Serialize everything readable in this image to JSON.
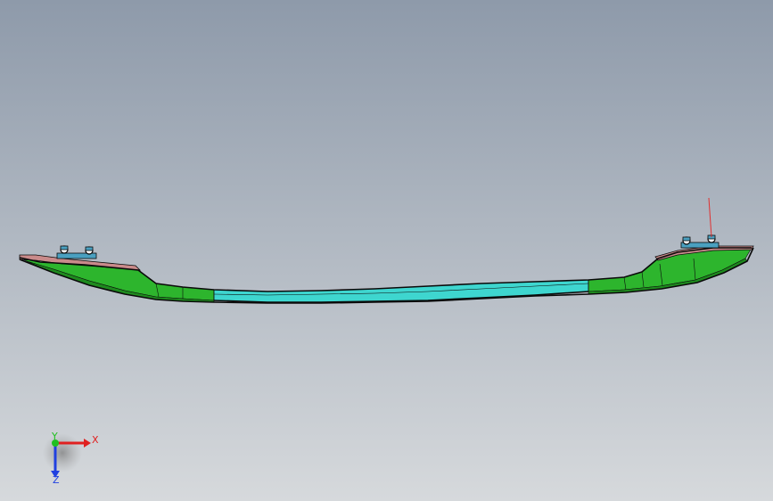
{
  "viewport": {
    "background_top": "#8e9aaa",
    "background_bottom": "#d6d9dc"
  },
  "model": {
    "body_color": "#2db52d",
    "body_dark_color": "#1e8a1e",
    "center_color": "#3ed6cf",
    "flange_color": "#c98a8a",
    "outline_color": "#0a0a0a",
    "hardware_color": "#4aa0c0",
    "sketch_line_color": "#e03030"
  },
  "triad": {
    "x_label": "X",
    "y_label": "Y",
    "z_label": "Z",
    "x_color": "#e02020",
    "y_color": "#20c020",
    "z_color": "#2040e0"
  }
}
